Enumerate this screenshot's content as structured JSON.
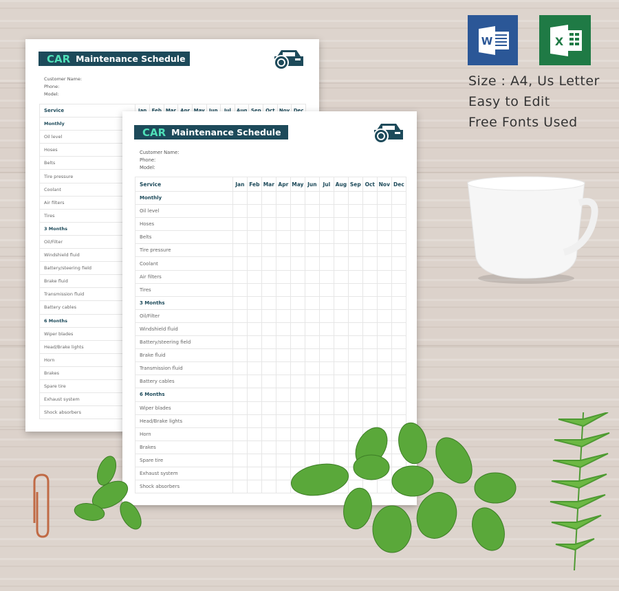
{
  "document": {
    "title_highlight": "CAR",
    "title_rest": "Maintenance Schedule",
    "fields": [
      "Customer Name:",
      "Phone:",
      "Model:"
    ],
    "service_header": "Service",
    "months": [
      "Jan",
      "Feb",
      "Mar",
      "Apr",
      "May",
      "Jun",
      "Jul",
      "Aug",
      "Sep",
      "Oct",
      "Nov",
      "Dec"
    ],
    "rows": [
      {
        "label": "Monthly",
        "section": true
      },
      {
        "label": "Oil level"
      },
      {
        "label": "Hoses"
      },
      {
        "label": "Belts"
      },
      {
        "label": "Tire pressure"
      },
      {
        "label": "Coolant"
      },
      {
        "label": "Air filters"
      },
      {
        "label": "Tires"
      },
      {
        "label": "3 Months",
        "section": true
      },
      {
        "label": "Oil/Filter"
      },
      {
        "label": "Windshield fluid"
      },
      {
        "label": "Battery/steering field"
      },
      {
        "label": "Brake fluid"
      },
      {
        "label": "Transmission fluid"
      },
      {
        "label": "Battery cables"
      },
      {
        "label": "6 Months",
        "section": true
      },
      {
        "label": "Wiper blades"
      },
      {
        "label": "Head/Brake lights"
      },
      {
        "label": "Horn"
      },
      {
        "label": "Brakes"
      },
      {
        "label": "Spare tire"
      },
      {
        "label": "Exhaust system"
      },
      {
        "label": "Shock absorbers"
      }
    ],
    "colors": {
      "title_bar": "#1d4a5a",
      "title_accent": "#4fe0b8"
    }
  },
  "promo": {
    "apps": [
      {
        "name": "word-icon",
        "letter": "W",
        "color": "#2b5797"
      },
      {
        "name": "excel-icon",
        "letter": "X",
        "color": "#1f7a45"
      }
    ],
    "features": [
      "Size : A4, Us Letter",
      "Easy to Edit",
      "Free Fonts Used"
    ]
  }
}
